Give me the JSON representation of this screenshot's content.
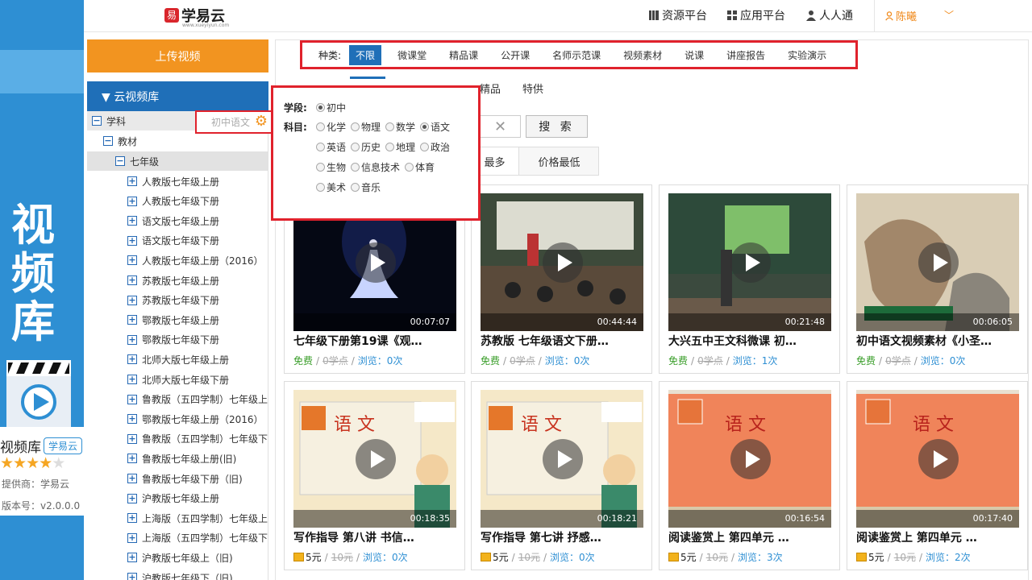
{
  "promo": {
    "vertical_title": [
      "视",
      "频",
      "库"
    ],
    "app_name": "视频库",
    "app_badge": "学易云",
    "rating": 4,
    "rating_max": 5,
    "provider": "提供商：学易云",
    "version": "版本号：v2.0.0.0"
  },
  "header": {
    "logo_text": "学易云",
    "logo_sub": "www.xueyiyun.com",
    "nav": [
      "资源平台",
      "应用平台",
      "人人通"
    ],
    "user": "陈曦"
  },
  "sidebar": {
    "upload_label": "上传视频",
    "library_label": "▼ 云视频库",
    "subject_label": "学科",
    "filter_hint": "初中语文",
    "textbook_label": "教材",
    "grade_label": "七年级",
    "books": [
      "人教版七年级上册",
      "人教版七年级下册",
      "语文版七年级上册",
      "语文版七年级下册",
      "人教版七年级上册（2016）",
      "苏教版七年级上册",
      "苏教版七年级下册",
      "鄂教版七年级上册",
      "鄂教版七年级下册",
      "北师大版七年级上册",
      "北师大版七年级下册",
      "鲁教版（五四学制）七年级上",
      "鄂教版七年级上册（2016）",
      "鲁教版（五四学制）七年级下",
      "鲁教版七年级上册(旧)",
      "鲁教版七年级下册（旧)",
      "沪教版七年级上册",
      "上海版（五四学制）七年级上",
      "上海版（五四学制）七年级下",
      "沪教版七年级上（旧)",
      "沪教版七年级下（旧)"
    ]
  },
  "popup": {
    "stage_label": "学段:",
    "stage_option": "初中",
    "subject_label": "科目:",
    "subjects": [
      [
        "化学",
        "物理",
        "数学",
        "语文"
      ],
      [
        "英语",
        "历史",
        "地理",
        "政治"
      ],
      [
        "生物",
        "信息技术",
        "体育"
      ],
      [
        "美术",
        "音乐"
      ]
    ],
    "selected_subject": "语文"
  },
  "categories": {
    "label": "种类:",
    "items": [
      "不限",
      "微课堂",
      "精品课",
      "公开课",
      "名师示范课",
      "视频素材",
      "说课",
      "讲座报告",
      "实验演示"
    ],
    "selected": "不限"
  },
  "row2": {
    "items": [
      "精品",
      "特供"
    ]
  },
  "search": {
    "clear": "✕",
    "button": "搜 索"
  },
  "sort": {
    "most": "最多",
    "price_low": "价格最低"
  },
  "cards": [
    {
      "title": "七年级下册第19课《观…",
      "duration": "00:07:07",
      "free": "免费",
      "orig": "0学点",
      "views": "浏览：0次",
      "theme": "dance"
    },
    {
      "title": "苏教版 七年级语文下册…",
      "duration": "00:44:44",
      "free": "免费",
      "orig": "0学点",
      "views": "浏览：0次",
      "theme": "class"
    },
    {
      "title": "大兴五中王文科微课 初…",
      "duration": "00:21:48",
      "free": "免费",
      "orig": "0学点",
      "views": "浏览：1次",
      "theme": "teacher"
    },
    {
      "title": "初中语文视频素材《小圣…",
      "duration": "00:06:05",
      "free": "免费",
      "orig": "0学点",
      "views": "浏览：0次",
      "theme": "painting"
    },
    {
      "title": "写作指导 第八讲 书信…",
      "duration": "00:18:35",
      "price": "5元",
      "orig": "10元",
      "views": "浏览：0次",
      "theme": "cartoon"
    },
    {
      "title": "写作指导 第七讲 抒感…",
      "duration": "00:18:21",
      "price": "5元",
      "orig": "10元",
      "views": "浏览：0次",
      "theme": "cartoon"
    },
    {
      "title": "阅读鉴赏上 第四单元 …",
      "duration": "00:16:54",
      "price": "5元",
      "orig": "10元",
      "views": "浏览：3次",
      "theme": "orange"
    },
    {
      "title": "阅读鉴赏上 第四单元 …",
      "duration": "00:17:40",
      "price": "5元",
      "orig": "10元",
      "views": "浏览：2次",
      "theme": "orange"
    }
  ],
  "colors": {
    "brand": "#1f6fb8",
    "accent": "#f29420",
    "highlight": "#e0222c",
    "free": "#3a9e2a"
  }
}
